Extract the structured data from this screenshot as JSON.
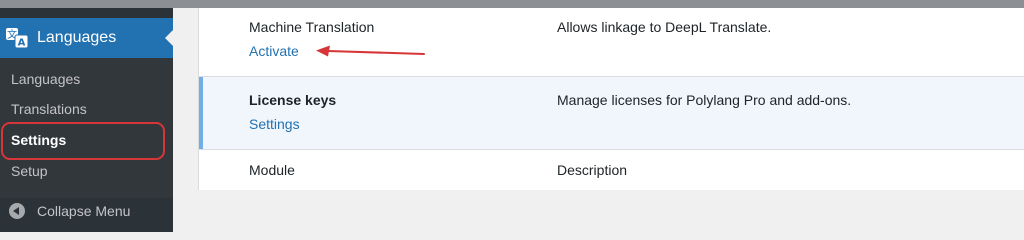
{
  "sidebar": {
    "menu_title": "Languages",
    "menu_icon": "translate-icon",
    "items": [
      {
        "label": "Languages",
        "current": false
      },
      {
        "label": "Translations",
        "current": false
      },
      {
        "label": "Settings",
        "current": true
      },
      {
        "label": "Setup",
        "current": false
      }
    ],
    "collapse_label": "Collapse Menu"
  },
  "modules": [
    {
      "title": "Machine Translation",
      "action": "Activate",
      "description": "Allows linkage to DeepL Translate."
    },
    {
      "title": "License keys",
      "action": "Settings",
      "description": "Manage licenses for Polylang Pro and add-ons."
    }
  ],
  "table_footer": {
    "module": "Module",
    "description": "Description"
  },
  "colors": {
    "accent": "#2271b1",
    "annotation": "#d63638",
    "sidebar_bg": "#2c3338"
  }
}
